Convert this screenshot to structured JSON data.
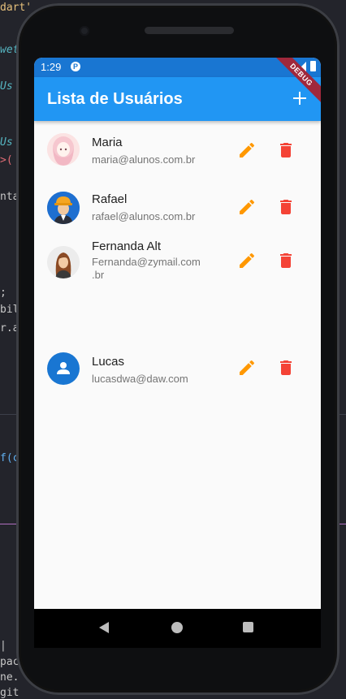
{
  "status_bar": {
    "time": "1:29",
    "app_icon_letter": "P",
    "debug_banner": "DEBUG"
  },
  "app_bar": {
    "title": "Lista de Usuários",
    "add_icon": "plus-icon"
  },
  "users": [
    {
      "name": "Maria",
      "email": "maria@alunos.com.br",
      "avatar": "anime-girl-avatar"
    },
    {
      "name": "Rafael",
      "email": "rafael@alunos.com.br",
      "avatar": "worker-helmet-avatar"
    },
    {
      "name": "Fernanda Alt",
      "email": "Fernanda@zymail.com.br",
      "email_line1": "Fernanda@zymail.com",
      "email_line2": ".br",
      "avatar": "woman-cartoon-avatar"
    },
    {
      "name": "Lucas",
      "email": "lucasdwa@daw.com",
      "avatar": "default-person-avatar"
    }
  ],
  "colors": {
    "app_bar": "#2196f3",
    "status_bar": "#1976d2",
    "edit_icon": "#ff9800",
    "delete_icon": "#f44336",
    "default_avatar": "#1976d2"
  },
  "background_code": {
    "lines": [
      "dart'",
      "wet",
      "Us",
      "Us",
      ">(",
      "nta",
      ";",
      "bil",
      "r.a",
      "f(c",
      "|",
      "pac",
      "ne.",
      "git"
    ]
  }
}
